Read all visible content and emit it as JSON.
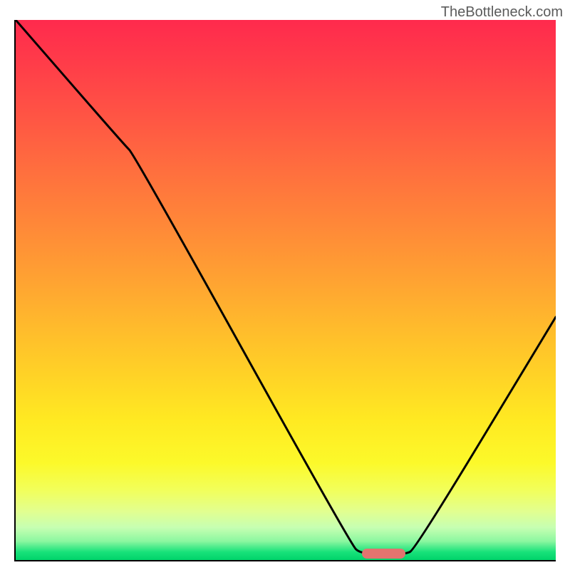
{
  "watermark": "TheBottleneck.com",
  "chart_data": {
    "type": "line",
    "title": "",
    "xlabel": "",
    "ylabel": "",
    "xlim": [
      0,
      100
    ],
    "ylim": [
      0,
      100
    ],
    "grid": false,
    "x": [
      0,
      20,
      22,
      62,
      64,
      72,
      74,
      100
    ],
    "values": [
      100,
      77,
      75,
      3,
      1,
      1,
      2,
      45
    ],
    "marker": {
      "x_start": 64,
      "x_end": 72,
      "y": 0.5,
      "color": "#e2746f"
    },
    "background_gradient": {
      "top": "#ff2a4d",
      "mid": "#ffe922",
      "bottom": "#00d36a"
    },
    "curve_color": "#000000",
    "curve_width": 3
  }
}
